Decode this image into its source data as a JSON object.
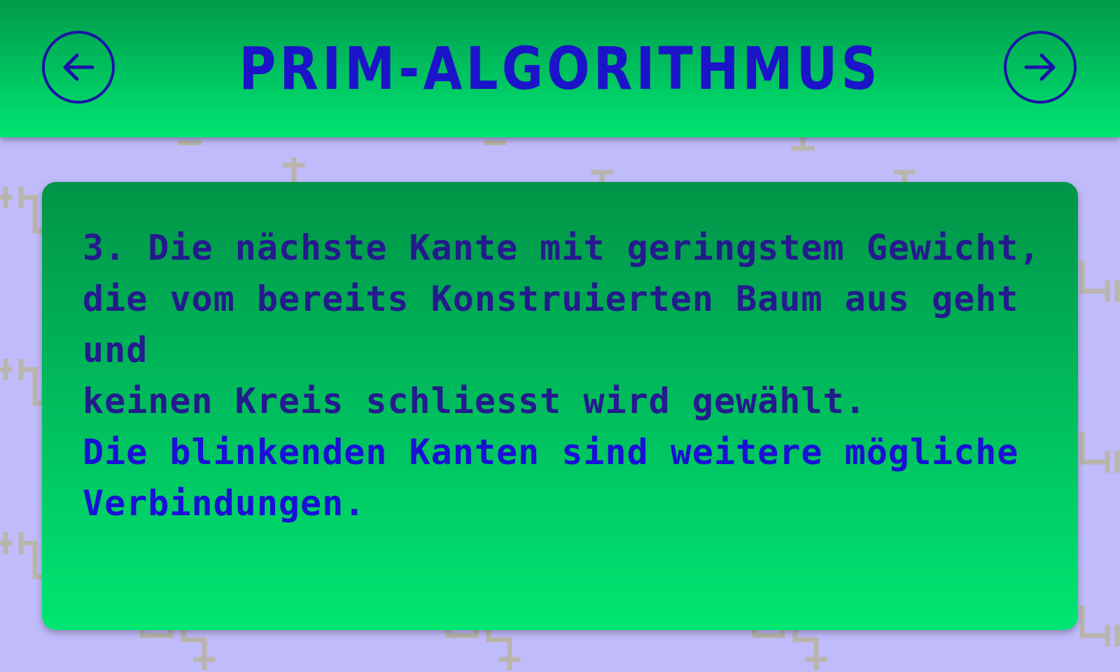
{
  "header": {
    "title": "PRIM-ALGORITHMUS",
    "prev_icon": "arrow-left-icon",
    "next_icon": "arrow-right-icon"
  },
  "card": {
    "step_text": "3.  Die nächste Kante mit geringstem Gewicht,\ndie vom bereits Konstruierten Baum aus geht und\nkeinen Kreis schliesst wird gewählt.",
    "hint_text": "Die blinkenden Kanten sind weitere mögliche\nVerbindungen."
  },
  "colors": {
    "background": "#c0bcfb",
    "accent_green": "#00e572",
    "dark_green": "#009447",
    "title_blue": "#1c14c8",
    "text_dark_blue": "#251a8e",
    "text_blue": "#1a10d6",
    "pattern_gray": "#b9b4b0"
  }
}
